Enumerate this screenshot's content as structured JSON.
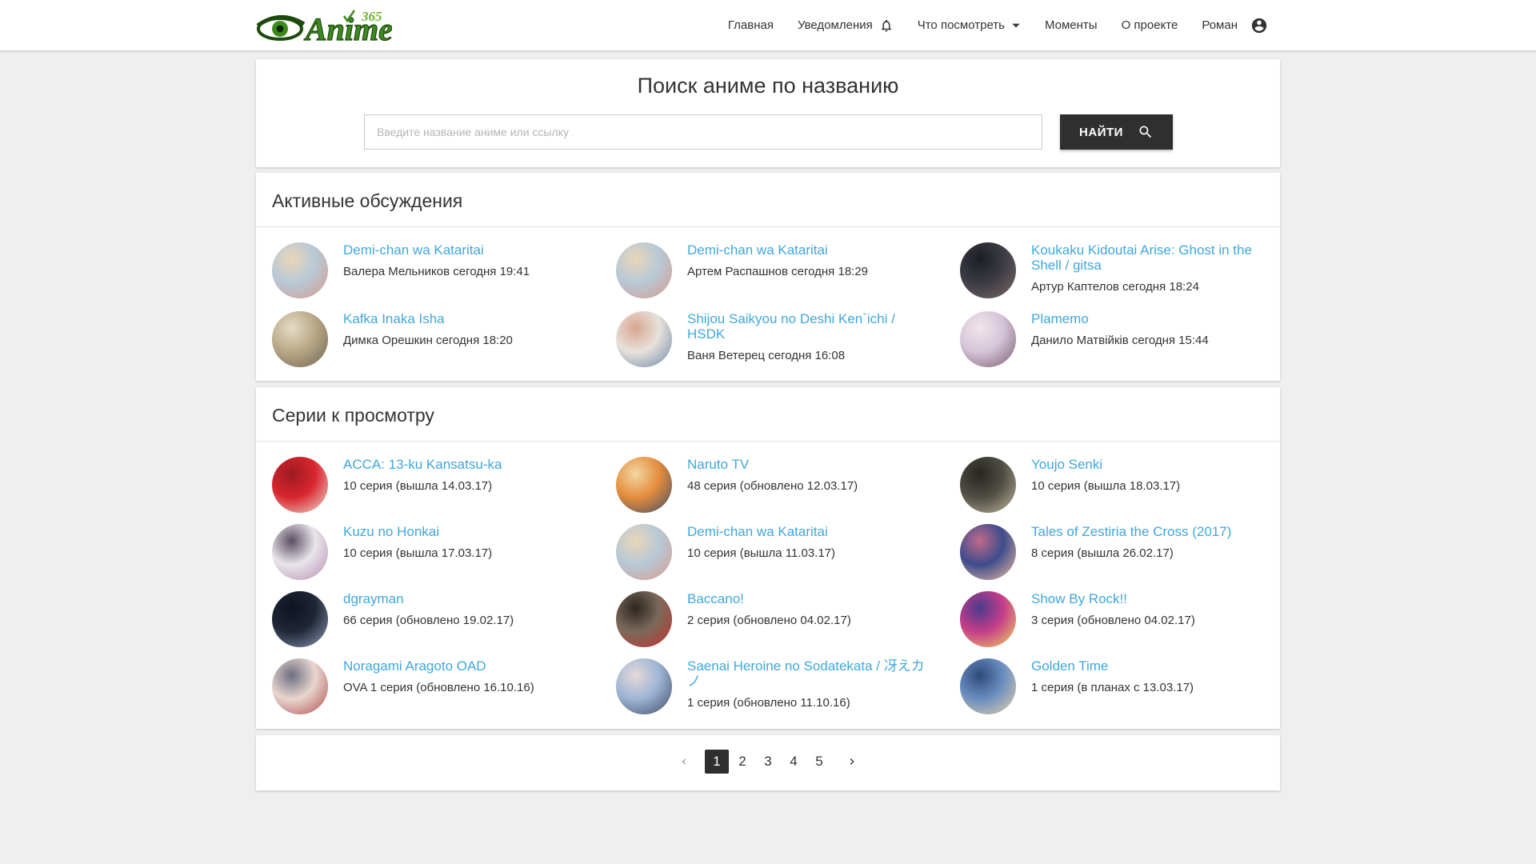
{
  "brand": {
    "logo_text": "Anime",
    "logo_number": "365",
    "colors": {
      "logo_green": "#3d8a1e",
      "logo_dark": "#1c4a0c",
      "link_blue": "#3fa7dc",
      "dark_button": "#2f2f2f"
    }
  },
  "nav": {
    "home": "Главная",
    "notifications": "Уведомления",
    "watch": "Что посмотреть",
    "moments": "Моменты",
    "about": "О проекте",
    "user": "Роман"
  },
  "search": {
    "title": "Поиск аниме по названию",
    "placeholder": "Введите название аниме или ссылку",
    "value": "",
    "button": "НАЙТИ"
  },
  "discussions": {
    "title": "Активные обсуждения",
    "items": [
      {
        "title": "Demi-chan wa Kataritai",
        "sub": "Валера Мельников сегодня 19:41",
        "thumb": [
          "#b7c9d6",
          "#d99a8c",
          "#e9d6b8"
        ]
      },
      {
        "title": "Demi-chan wa Kataritai",
        "sub": "Артем Распашнов сегодня 18:29",
        "thumb": [
          "#b7c9d6",
          "#d99a8c",
          "#e9d6b8"
        ]
      },
      {
        "title": "Koukaku Kidoutai Arise: Ghost in the Shell / gitsa",
        "sub": "Артур Каптелов сегодня 18:24",
        "thumb": [
          "#3b3b45",
          "#7c6a64",
          "#1d1d24"
        ]
      },
      {
        "title": "Kafka Inaka Isha",
        "sub": "Димка Орешкин сегодня 18:20",
        "thumb": [
          "#b9a887",
          "#6f6452",
          "#e4dcc6"
        ]
      },
      {
        "title": "Shijou Saikyou no Deshi Ken`ichi / HSDK",
        "sub": "Ваня Ветерец сегодня 16:08",
        "thumb": [
          "#e7e2dc",
          "#6d86a8",
          "#d8a58f"
        ]
      },
      {
        "title": "Plamemo",
        "sub": "Данило Матвійків сегодня 15:44",
        "thumb": [
          "#d4c5d8",
          "#7b5a6e",
          "#f2e7ea"
        ]
      }
    ]
  },
  "episodes": {
    "title": "Серии к просмотру",
    "items": [
      {
        "title": "ACCA: 13-ku Kansatsu-ka",
        "sub": "10 серия (вышла 14.03.17)",
        "thumb": [
          "#d8262e",
          "#f1e3d7",
          "#9e1b22"
        ]
      },
      {
        "title": "Naruto TV",
        "sub": "48 серия (обновлено 12.03.17)",
        "thumb": [
          "#e48d3c",
          "#3f4a66",
          "#f3d7a2"
        ]
      },
      {
        "title": "Youjo Senki",
        "sub": "10 серия (вышла 18.03.17)",
        "thumb": [
          "#4f4e45",
          "#c1b79b",
          "#26261f"
        ]
      },
      {
        "title": "Kuzu no Honkai",
        "sub": "10 серия (вышла 17.03.17)",
        "thumb": [
          "#e9e5ea",
          "#b38eb0",
          "#5b4e63"
        ]
      },
      {
        "title": "Demi-chan wa Kataritai",
        "sub": "10 серия (вышла 11.03.17)",
        "thumb": [
          "#b7c9d6",
          "#d99a8c",
          "#e9d6b8"
        ]
      },
      {
        "title": "Tales of Zestiria the Cross (2017)",
        "sub": "8 серия (вышла 26.02.17)",
        "thumb": [
          "#3e4c8c",
          "#f2c0a1",
          "#c06a8a"
        ]
      },
      {
        "title": "dgrayman",
        "sub": "66 серия (обновлено 19.02.17)",
        "thumb": [
          "#1f2636",
          "#8e9cb8",
          "#0f1320"
        ]
      },
      {
        "title": "Baccano!",
        "sub": "2 серия (обновлено 04.02.17)",
        "thumb": [
          "#7a6a5a",
          "#c92f2f",
          "#2d2520"
        ]
      },
      {
        "title": "Show By Rock!!",
        "sub": "3 серия (обновлено 04.02.17)",
        "thumb": [
          "#c43d8a",
          "#f2d85a",
          "#4b3b8c"
        ]
      },
      {
        "title": "Noragami Aragoto OAD",
        "sub": "OVA 1 серия (обновлено 16.10.16)",
        "thumb": [
          "#e8d6cf",
          "#b04a48",
          "#6d6f80"
        ]
      },
      {
        "title": "Saenai Heroine no Sodatekata / 冴えカノ",
        "sub": "1 серия (обновлено 11.10.16)",
        "thumb": [
          "#9db5d4",
          "#3e4a66",
          "#e6d9d9"
        ]
      },
      {
        "title": "Golden Time",
        "sub": "1 серия (в планах с 13.03.17)",
        "thumb": [
          "#6a8ec0",
          "#e9d3a8",
          "#2f4a7a"
        ]
      }
    ]
  },
  "pagination": {
    "pages": [
      "1",
      "2",
      "3",
      "4",
      "5"
    ],
    "current": "1"
  }
}
